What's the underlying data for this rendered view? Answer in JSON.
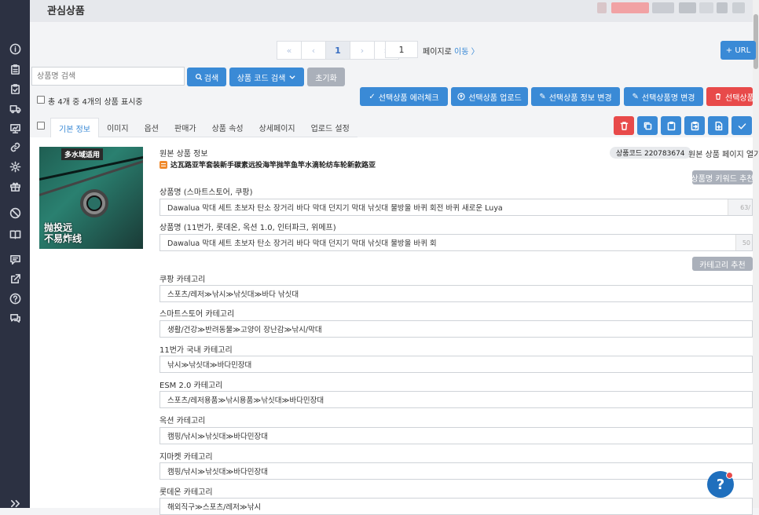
{
  "header": {
    "title": "관심상품"
  },
  "pagination": {
    "first": "«",
    "prev": "‹",
    "current": "1",
    "next": "›",
    "last": "»",
    "page_input": "1",
    "goto_prefix": "페이지로",
    "goto_link": "이동 〉"
  },
  "toolbar": {
    "add_url_label": "+ URL"
  },
  "search": {
    "placeholder": "상품명 검색",
    "search_button": "검색",
    "code_search_button": "상품 코드 검색",
    "reset_button": "초기화",
    "count_text": "총 4개 중 4개의 상품 표시중"
  },
  "actions": {
    "error_check": "선택상품 에러체크",
    "upload": "선택상품 업로드",
    "info_change": "선택상품 정보 변경",
    "name_change": "선택상품명 변경",
    "delete": "선택상품 삭제"
  },
  "tabs": [
    "기본 정보",
    "이미지",
    "옵션",
    "판매가",
    "상품 속성",
    "상세페이지",
    "업로드 설정"
  ],
  "product": {
    "image_tag": "多水域适用",
    "image_text_1": "抛投远",
    "image_text_2": "不易炸线",
    "original_label": "원본 상품 정보",
    "original_title": "达瓦路亚竿套装新手碳素远投海竿抛竿鱼竿水滴轮纺车轮新款路亚",
    "code_badge": "상품코드 220783674",
    "original_page_link": "원본 상품 페이지 열기",
    "keyword_button": "상품명 키워드 추천",
    "category_button": "카테고리 추천",
    "name_label_1": "상품명 (스마트스토어, 쿠팡)",
    "name_value_1": "Dawalua 막대 세트 초보자 탄소 장거리 바다 막대 던지기 막대 낚싯대 물방울 바퀴 회전 바퀴 새로운 Luya",
    "name_counter_1": "63/",
    "name_label_2": "상품명 (11번가, 롯데온, 옥션 1.0, 인터파크, 위메프)",
    "name_value_2": "Dawalua 막대 세트 초보자 탄소 장거리 바다 막대 던지기 막대 낚싯대 물방울 바퀴 회",
    "name_counter_2": "50",
    "categories": [
      {
        "label": "쿠팡 카테고리",
        "value": "스포츠/레저≫낚시≫낚싯대≫바다 낚싯대"
      },
      {
        "label": "스마트스토어 카테고리",
        "value": "생활/건강≫반려동물≫고양이 장난감≫낚시/막대"
      },
      {
        "label": "11번가 국내 카테고리",
        "value": "낚시≫낚싯대≫바다민장대"
      },
      {
        "label": "ESM 2.0 카테고리",
        "value": "스포츠/레저용품≫낚시용품≫낚싯대≫바다민장대"
      },
      {
        "label": "옥션 카테고리",
        "value": "캠핑/낚시≫낚싯대≫바다민장대"
      },
      {
        "label": "지마켓 카테고리",
        "value": "캠핑/낚시≫낚싯대≫바다민장대"
      },
      {
        "label": "롯데온 카테고리",
        "value": "해외직구≫스포츠/레저≫낚시"
      }
    ]
  },
  "colors": {
    "primary": "#3a8ad6",
    "danger": "#e84a4a",
    "sidebar": "#2c3142"
  }
}
